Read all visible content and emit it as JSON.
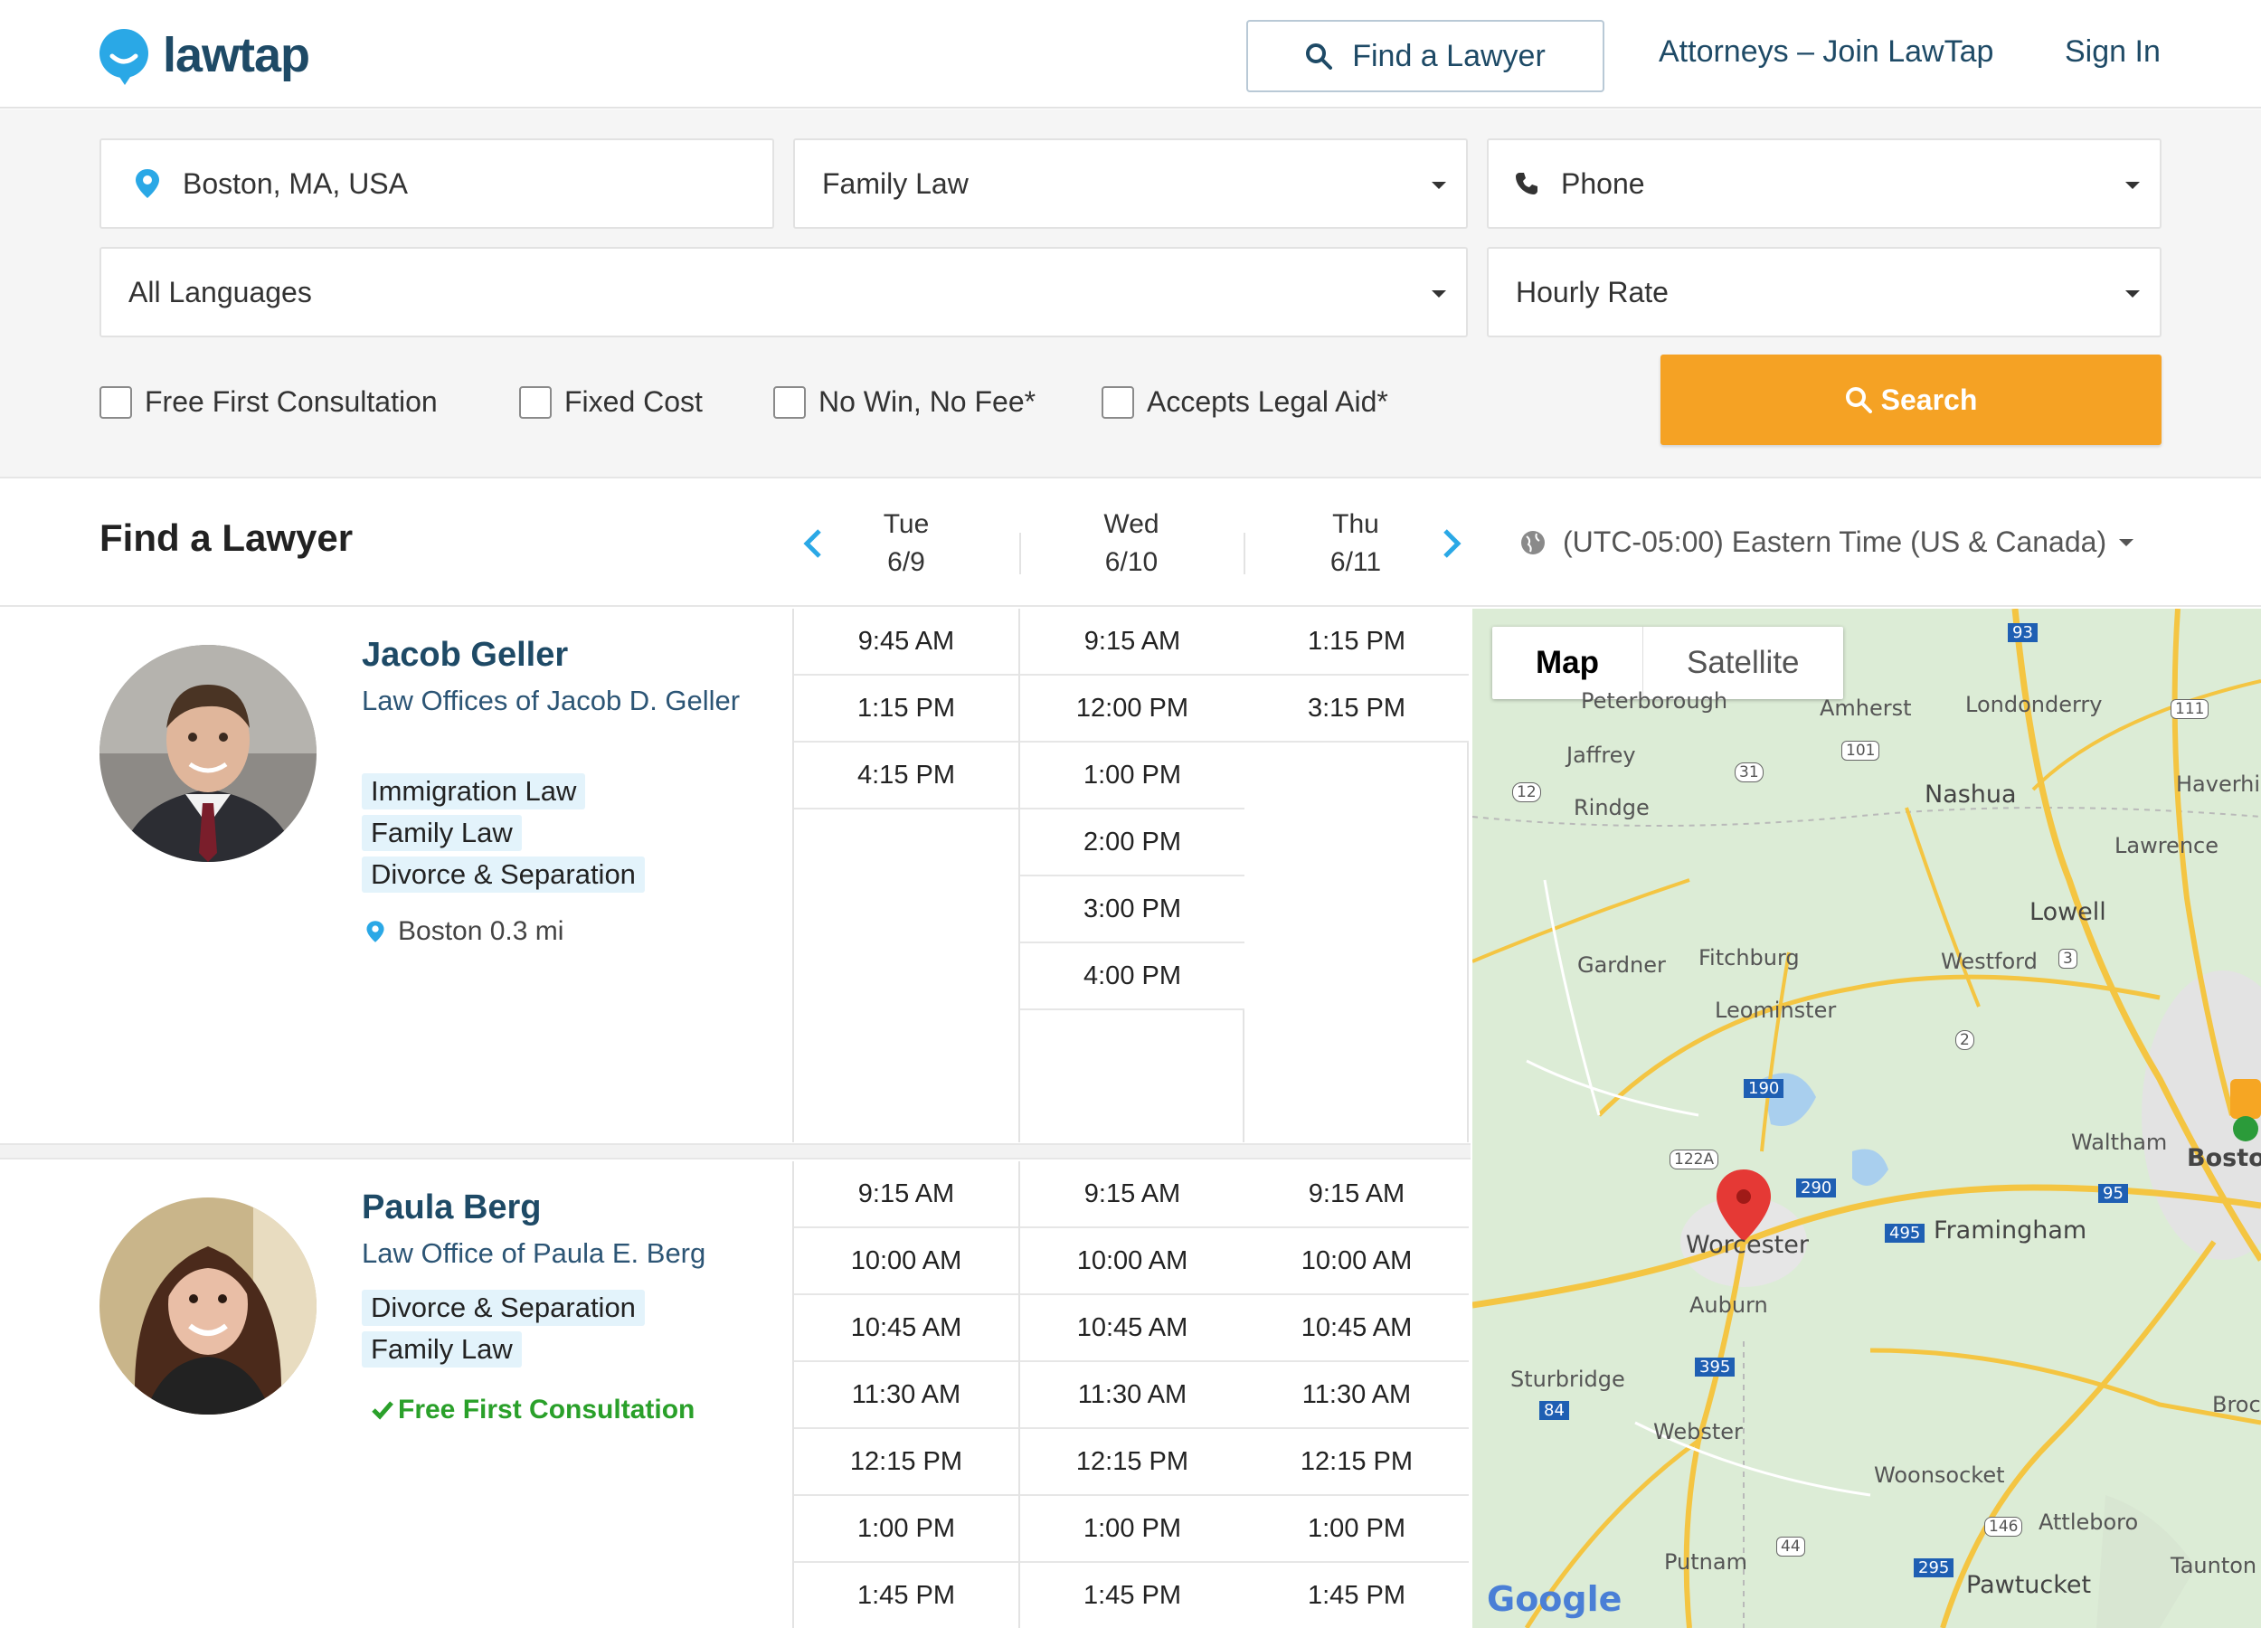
{
  "header": {
    "logo_text": "lawtap",
    "find_lawyer_label": "Find a Lawyer",
    "attorneys_join_label": "Attorneys – Join LawTap",
    "sign_in_label": "Sign In"
  },
  "filters": {
    "location": "Boston, MA, USA",
    "practice_area": "Family Law",
    "meeting_type": "Phone",
    "language": "All Languages",
    "rate": "Hourly Rate",
    "checkboxes": [
      "Free First Consultation",
      "Fixed Cost",
      "No Win, No Fee*",
      "Accepts Legal Aid*"
    ],
    "search_label": "Search"
  },
  "results": {
    "title": "Find a Lawyer",
    "days": [
      {
        "dow": "Tue",
        "date": "6/9"
      },
      {
        "dow": "Wed",
        "date": "6/10"
      },
      {
        "dow": "Thu",
        "date": "6/11"
      }
    ],
    "timezone": "(UTC-05:00) Eastern Time (US & Canada)"
  },
  "lawyers": [
    {
      "name": "Jacob Geller",
      "firm": "Law Offices of Jacob D. Geller",
      "tags": [
        "Immigration Law",
        "Family Law",
        "Divorce & Separation"
      ],
      "location": "Boston 0.3 mi",
      "slots": [
        [
          "9:45 AM",
          "1:15 PM",
          "4:15 PM"
        ],
        [
          "9:15 AM",
          "12:00 PM",
          "1:00 PM",
          "2:00 PM",
          "3:00 PM",
          "4:00 PM"
        ],
        [
          "1:15 PM",
          "3:15 PM"
        ]
      ]
    },
    {
      "name": "Paula Berg",
      "firm": "Law Office of Paula E. Berg",
      "tags": [
        "Divorce & Separation",
        "Family Law"
      ],
      "badge": "Free First Consultation",
      "slots": [
        [
          "9:15 AM",
          "10:00 AM",
          "10:45 AM",
          "11:30 AM",
          "12:15 PM",
          "1:00 PM",
          "1:45 PM"
        ],
        [
          "9:15 AM",
          "10:00 AM",
          "10:45 AM",
          "11:30 AM",
          "12:15 PM",
          "1:00 PM",
          "1:45 PM"
        ],
        [
          "9:15 AM",
          "10:00 AM",
          "10:45 AM",
          "11:30 AM",
          "12:15 PM",
          "1:00 PM",
          "1:45 PM"
        ]
      ]
    }
  ],
  "map": {
    "tabs": [
      "Map",
      "Satellite"
    ],
    "towns": [
      "Peterborough",
      "Amherst",
      "Londonderry",
      "Haverhill",
      "Jaffrey",
      "Nashua",
      "Rindge",
      "Lawrence",
      "Lowell",
      "Gardner",
      "Fitchburg",
      "Westford",
      "Leominster",
      "Waltham",
      "Boston",
      "Worcester",
      "Framingham",
      "Auburn",
      "Sturbridge",
      "Webster",
      "Woonsocket",
      "Attleboro",
      "Putnam",
      "Pawtucket",
      "Taunton",
      "Brockton"
    ],
    "routes": [
      "93",
      "101",
      "111",
      "12",
      "31",
      "3",
      "2",
      "190",
      "122A",
      "290",
      "95",
      "495",
      "395",
      "84",
      "146",
      "44",
      "295"
    ],
    "attribution": "Google"
  }
}
